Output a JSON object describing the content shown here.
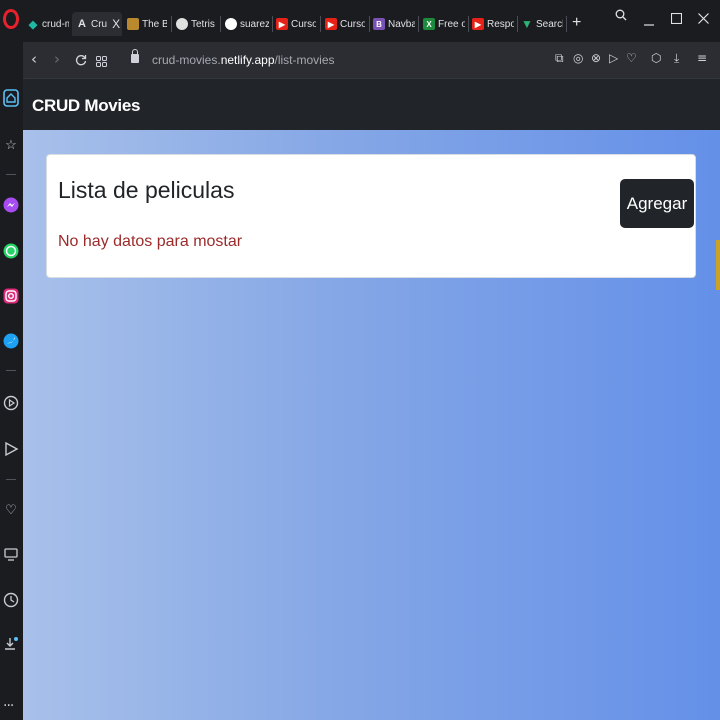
{
  "browser": {
    "tabs": [
      {
        "label": "crud-m",
        "favicon": "diamond",
        "color": "#1fb7a6"
      },
      {
        "label": "Cru",
        "favicon": "A",
        "color": "#2b2d33",
        "active": true
      },
      {
        "label": "The Bi",
        "favicon": "img",
        "color": "#b9892e"
      },
      {
        "label": "Tetris",
        "favicon": "globe",
        "color": "#e0e0e0"
      },
      {
        "label": "suarez",
        "favicon": "github",
        "color": "#ffffff"
      },
      {
        "label": "Curso",
        "favicon": "youtube",
        "color": "#e62117"
      },
      {
        "label": "Curso",
        "favicon": "youtube",
        "color": "#e62117"
      },
      {
        "label": "Navba",
        "favicon": "B",
        "color": "#7952b3"
      },
      {
        "label": "Free o",
        "favicon": "X",
        "color": "#1d8b3c"
      },
      {
        "label": "Respo",
        "favicon": "youtube",
        "color": "#e62117"
      },
      {
        "label": "Search",
        "favicon": "V",
        "color": "#2bb673"
      }
    ],
    "tab_close_glyph": "X",
    "new_tab_glyph": "+",
    "url_prefix": "crud-movies.",
    "url_domain": "netlify.app",
    "url_path": "/list-movies"
  },
  "sidebar": {
    "icons": [
      "home-icon",
      "star-icon",
      "messenger-icon",
      "whatsapp-icon",
      "instagram-icon",
      "twitter-icon",
      "player-icon",
      "flow-icon",
      "heart-icon",
      "history-icon",
      "clock-icon",
      "download-icon"
    ],
    "more": "..."
  },
  "app": {
    "brand": "CRUD Movies",
    "card_title": "Lista de peliculas",
    "empty_message": "No hay datos para mostar",
    "add_button": "Agregar"
  },
  "colors": {
    "navbar": "#212529",
    "gradient_start": "#a8c0ea",
    "gradient_end": "#6490e8",
    "empty_message": "#9b2b2b"
  }
}
